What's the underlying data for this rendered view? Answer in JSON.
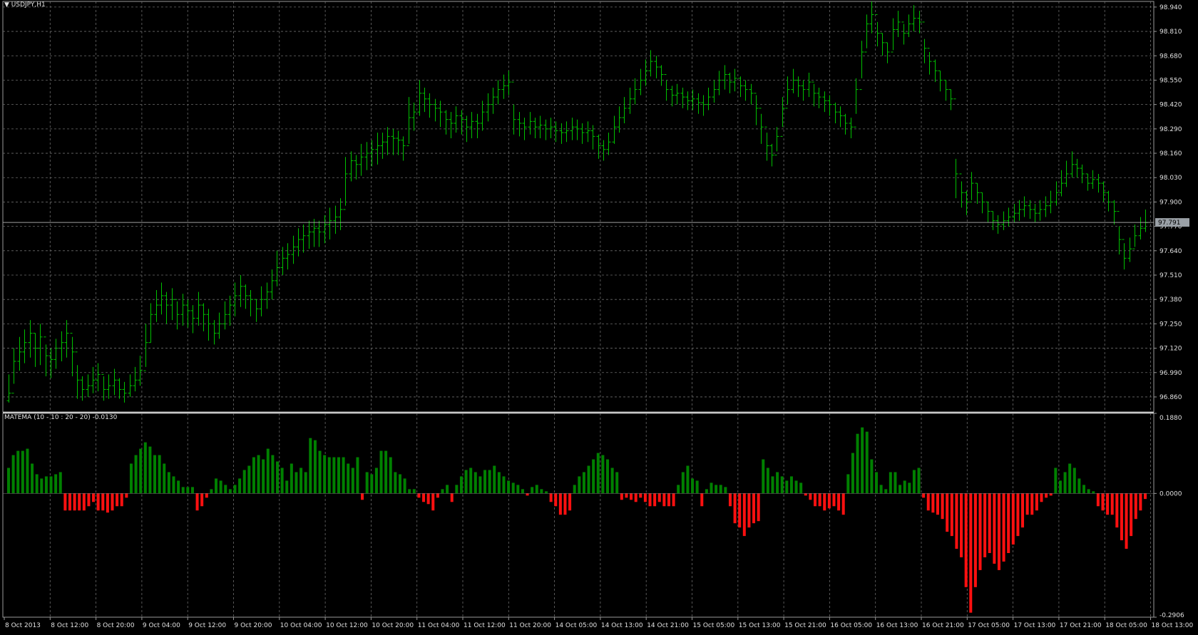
{
  "chart": {
    "symbol_label": "USDJPY,H1",
    "current_price_label": "97.791",
    "colors": {
      "background": "#000000",
      "grid": "#6b6b6b",
      "frame": "#9a9a9a",
      "bar": "#00c000",
      "hist_up": "#008000",
      "hist_down": "#ff1010",
      "price_tag_bg": "#9aa0a6",
      "axis_text": "#e0e0e0"
    }
  },
  "indicator": {
    "title": "MATEMA (10 - 10 : 20 - 20) -0.0130",
    "axis_labels": [
      "0.1880",
      "0.0000",
      "-0.2906"
    ]
  },
  "chart_data": [
    {
      "type": "ohlc",
      "title": "USDJPY,H1",
      "ylim": [
        96.78,
        98.97
      ],
      "y_ticks": [
        "98.940",
        "98.810",
        "98.680",
        "98.550",
        "98.420",
        "98.290",
        "98.160",
        "98.030",
        "97.900",
        "97.770",
        "97.640",
        "97.510",
        "97.380",
        "97.250",
        "97.120",
        "96.990",
        "96.860"
      ],
      "x_ticks": [
        "8 Oct 2013",
        "8 Oct 12:00",
        "8 Oct 20:00",
        "9 Oct 04:00",
        "9 Oct 12:00",
        "9 Oct 20:00",
        "10 Oct 04:00",
        "10 Oct 12:00",
        "10 Oct 20:00",
        "11 Oct 04:00",
        "11 Oct 12:00",
        "11 Oct 20:00",
        "14 Oct 05:00",
        "14 Oct 13:00",
        "14 Oct 21:00",
        "15 Oct 05:00",
        "15 Oct 13:00",
        "15 Oct 21:00",
        "16 Oct 05:00",
        "16 Oct 13:00",
        "16 Oct 21:00",
        "17 Oct 05:00",
        "17 Oct 13:00",
        "17 Oct 21:00",
        "18 Oct 05:00",
        "18 Oct 13:00"
      ],
      "closes": [
        96.88,
        97.05,
        97.1,
        97.15,
        97.2,
        97.12,
        97.18,
        97.08,
        97.06,
        97.12,
        97.15,
        97.2,
        97.1,
        96.95,
        96.9,
        96.92,
        96.95,
        96.98,
        96.9,
        96.92,
        96.95,
        96.9,
        96.88,
        96.92,
        96.95,
        97.0,
        97.15,
        97.3,
        97.35,
        97.4,
        97.35,
        97.38,
        97.3,
        97.35,
        97.32,
        97.28,
        97.35,
        97.3,
        97.25,
        97.2,
        97.25,
        97.3,
        97.35,
        97.4,
        97.45,
        97.4,
        97.38,
        97.33,
        97.38,
        97.42,
        97.48,
        97.55,
        97.6,
        97.62,
        97.66,
        97.7,
        97.72,
        97.74,
        97.76,
        97.74,
        97.78,
        97.8,
        97.82,
        97.86,
        98.05,
        98.12,
        98.1,
        98.14,
        98.16,
        98.18,
        98.2,
        98.22,
        98.25,
        98.24,
        98.23,
        98.2,
        98.35,
        98.38,
        98.48,
        98.45,
        98.42,
        98.4,
        98.38,
        98.34,
        98.32,
        98.36,
        98.34,
        98.3,
        98.33,
        98.32,
        98.38,
        98.42,
        98.46,
        98.5,
        98.52,
        98.54,
        98.34,
        98.32,
        98.3,
        98.33,
        98.3,
        98.31,
        98.29,
        98.3,
        98.28,
        98.27,
        98.28,
        98.3,
        98.29,
        98.27,
        98.28,
        98.25,
        98.2,
        98.18,
        98.22,
        98.3,
        98.35,
        98.4,
        98.45,
        98.5,
        98.55,
        98.6,
        98.65,
        98.62,
        98.58,
        98.5,
        98.47,
        98.48,
        98.46,
        98.44,
        98.45,
        98.43,
        98.42,
        98.46,
        98.5,
        98.55,
        98.58,
        98.54,
        98.56,
        98.52,
        98.5,
        98.48,
        98.4,
        98.3,
        98.2,
        98.15,
        98.25,
        98.4,
        98.5,
        98.55,
        98.52,
        98.5,
        98.54,
        98.48,
        98.46,
        98.44,
        98.42,
        98.38,
        98.36,
        98.32,
        98.3,
        98.5,
        98.7,
        98.85,
        98.9,
        98.8,
        98.75,
        98.7,
        98.82,
        98.86,
        98.8,
        98.85,
        98.88,
        98.86,
        98.72,
        98.65,
        98.6,
        98.55,
        98.5,
        98.45,
        98.05,
        97.95,
        97.9,
        98.0,
        97.95,
        97.9,
        97.85,
        97.8,
        97.78,
        97.8,
        97.82,
        97.84,
        97.86,
        97.88,
        97.86,
        97.84,
        97.86,
        97.88,
        97.9,
        97.95,
        98.0,
        98.05,
        98.1,
        98.08,
        98.05,
        98.0,
        98.02,
        98.0,
        97.95,
        97.9,
        97.85,
        97.7,
        97.6,
        97.65,
        97.72,
        97.76,
        97.79
      ],
      "lows": [
        96.83,
        96.93,
        97.0,
        97.04,
        97.07,
        97.02,
        97.03,
        96.97,
        96.96,
        97.01,
        97.05,
        97.07,
        96.97,
        96.85,
        96.84,
        96.86,
        96.88,
        96.89,
        96.84,
        96.85,
        96.87,
        96.85,
        96.83,
        96.86,
        96.89,
        96.92,
        97.02,
        97.15,
        97.26,
        97.3,
        97.25,
        97.27,
        97.22,
        97.24,
        97.23,
        97.2,
        97.24,
        97.21,
        97.16,
        97.14,
        97.17,
        97.22,
        97.24,
        97.29,
        97.34,
        97.33,
        97.29,
        97.26,
        97.29,
        97.33,
        97.38,
        97.45,
        97.51,
        97.54,
        97.57,
        97.61,
        97.63,
        97.65,
        97.66,
        97.66,
        97.68,
        97.7,
        97.73,
        97.75,
        97.88,
        98.01,
        98.02,
        98.04,
        98.07,
        98.09,
        98.1,
        98.13,
        98.15,
        98.15,
        98.15,
        98.12,
        98.21,
        98.28,
        98.36,
        98.38,
        98.35,
        98.33,
        98.3,
        98.26,
        98.24,
        98.27,
        98.26,
        98.22,
        98.24,
        98.24,
        98.28,
        98.33,
        98.37,
        98.42,
        98.45,
        98.47,
        98.26,
        98.25,
        98.23,
        98.26,
        98.24,
        98.24,
        98.23,
        98.24,
        98.22,
        98.21,
        98.22,
        98.23,
        98.23,
        98.21,
        98.22,
        98.18,
        98.13,
        98.12,
        98.15,
        98.21,
        98.27,
        98.32,
        98.37,
        98.42,
        98.47,
        98.52,
        98.57,
        98.56,
        98.52,
        98.44,
        98.41,
        98.42,
        98.4,
        98.39,
        98.39,
        98.37,
        98.36,
        98.39,
        98.43,
        98.47,
        98.5,
        98.48,
        98.49,
        98.46,
        98.44,
        98.42,
        98.31,
        98.21,
        98.12,
        98.09,
        98.17,
        98.3,
        98.42,
        98.48,
        98.46,
        98.44,
        98.46,
        98.41,
        98.4,
        98.38,
        98.36,
        98.32,
        98.3,
        98.26,
        98.24,
        98.37,
        98.56,
        98.72,
        98.8,
        98.73,
        98.68,
        98.64,
        98.71,
        98.78,
        98.74,
        98.78,
        98.81,
        98.8,
        98.64,
        98.58,
        98.54,
        98.49,
        98.44,
        98.39,
        97.92,
        97.87,
        97.83,
        97.91,
        97.89,
        97.84,
        97.79,
        97.75,
        97.73,
        97.75,
        97.77,
        97.79,
        97.8,
        97.82,
        97.81,
        97.79,
        97.8,
        97.82,
        97.84,
        97.88,
        97.93,
        97.98,
        98.03,
        98.03,
        98.0,
        97.96,
        97.97,
        97.95,
        97.9,
        97.85,
        97.78,
        97.62,
        97.54,
        97.58,
        97.66,
        97.7,
        97.74
      ],
      "highs": [
        96.98,
        97.12,
        97.18,
        97.22,
        97.27,
        97.2,
        97.25,
        97.14,
        97.12,
        97.17,
        97.21,
        97.27,
        97.18,
        97.03,
        96.97,
        96.98,
        97.02,
        97.04,
        96.97,
        96.98,
        97.01,
        96.96,
        96.94,
        96.98,
        97.02,
        97.08,
        97.25,
        97.36,
        97.43,
        97.47,
        97.42,
        97.44,
        97.37,
        97.41,
        97.38,
        97.35,
        97.42,
        97.36,
        97.33,
        97.27,
        97.31,
        97.37,
        97.4,
        97.47,
        97.51,
        97.46,
        97.43,
        97.38,
        97.45,
        97.47,
        97.54,
        97.64,
        97.66,
        97.68,
        97.72,
        97.76,
        97.78,
        97.8,
        97.81,
        97.8,
        97.83,
        97.87,
        97.88,
        97.92,
        98.14,
        98.17,
        98.15,
        98.21,
        98.22,
        98.23,
        98.27,
        98.27,
        98.3,
        98.29,
        98.28,
        98.25,
        98.46,
        98.43,
        98.55,
        98.51,
        98.48,
        98.45,
        98.44,
        98.39,
        98.38,
        98.41,
        98.39,
        98.36,
        98.38,
        98.37,
        98.44,
        98.48,
        98.51,
        98.55,
        98.58,
        98.6,
        98.42,
        98.38,
        98.35,
        98.38,
        98.35,
        98.36,
        98.34,
        98.35,
        98.33,
        98.32,
        98.33,
        98.35,
        98.34,
        98.32,
        98.33,
        98.31,
        98.26,
        98.23,
        98.27,
        98.36,
        98.41,
        98.46,
        98.51,
        98.56,
        98.61,
        98.66,
        98.71,
        98.68,
        98.63,
        98.55,
        98.52,
        98.53,
        98.51,
        98.49,
        98.5,
        98.48,
        98.47,
        98.51,
        98.55,
        98.6,
        98.63,
        98.59,
        98.61,
        98.57,
        98.55,
        98.53,
        98.47,
        98.37,
        98.27,
        98.21,
        98.3,
        98.46,
        98.57,
        98.61,
        98.57,
        98.55,
        98.59,
        98.53,
        98.51,
        98.49,
        98.47,
        98.43,
        98.41,
        98.37,
        98.35,
        98.56,
        98.76,
        98.9,
        98.97,
        98.86,
        98.8,
        98.75,
        98.88,
        98.92,
        98.85,
        98.9,
        98.95,
        98.92,
        98.77,
        98.7,
        98.66,
        98.6,
        98.55,
        98.5,
        98.13,
        98.01,
        97.96,
        98.06,
        98.0,
        97.95,
        97.9,
        97.85,
        97.83,
        97.85,
        97.87,
        97.89,
        97.91,
        97.93,
        97.91,
        97.89,
        97.91,
        97.93,
        97.96,
        98.01,
        98.07,
        98.12,
        98.17,
        98.13,
        98.1,
        98.05,
        98.07,
        98.05,
        98.01,
        97.96,
        97.91,
        97.77,
        97.68,
        97.71,
        97.78,
        97.82,
        97.86
      ]
    },
    {
      "type": "bar",
      "title": "MATEMA (10 - 10 : 20 - 20) -0.0130",
      "ylim": [
        -0.2906,
        0.188
      ],
      "values": [
        0.06,
        0.09,
        0.1,
        0.1,
        0.105,
        0.07,
        0.045,
        0.035,
        0.04,
        0.04,
        0.045,
        0.05,
        -0.04,
        -0.04,
        -0.04,
        -0.04,
        -0.04,
        -0.03,
        -0.02,
        -0.04,
        -0.04,
        -0.045,
        -0.04,
        -0.03,
        -0.03,
        -0.01,
        0.07,
        0.09,
        0.105,
        0.12,
        0.11,
        0.09,
        0.09,
        0.07,
        0.05,
        0.04,
        0.03,
        0.015,
        0.015,
        0.015,
        -0.04,
        -0.03,
        -0.01,
        0.01,
        0.035,
        0.03,
        0.02,
        0.01,
        0.02,
        0.035,
        0.055,
        0.065,
        0.085,
        0.09,
        0.08,
        0.105,
        0.09,
        0.075,
        0.06,
        0.03,
        0.07,
        0.05,
        0.06,
        0.05,
        0.13,
        0.125,
        0.1,
        0.09,
        0.085,
        0.085,
        0.085,
        0.085,
        0.07,
        0.06,
        0.085,
        -0.015,
        0.05,
        0.045,
        0.06,
        0.1,
        0.1,
        0.085,
        0.05,
        0.045,
        0.035,
        0.01,
        0.01,
        -0.01,
        -0.02,
        -0.025,
        -0.04,
        -0.01,
        0.01,
        0.02,
        -0.02,
        0.02,
        0.04,
        0.055,
        0.06,
        0.05,
        0.04,
        0.055,
        0.055,
        0.065,
        0.05,
        0.04,
        0.03,
        0.025,
        0.02,
        0.01,
        -0.005,
        0.015,
        0.02,
        0.01,
        0.005,
        -0.02,
        -0.03,
        -0.05,
        -0.05,
        -0.04,
        0.02,
        0.04,
        0.05,
        0.065,
        0.08,
        0.095,
        0.09,
        0.08,
        0.06,
        0.05,
        -0.015,
        -0.01,
        -0.015,
        -0.02,
        -0.01,
        -0.02,
        -0.03,
        -0.03,
        -0.02,
        -0.03,
        -0.03,
        -0.03,
        0.02,
        0.05,
        0.065,
        0.035,
        0.03,
        -0.03,
        0.01,
        0.025,
        0.02,
        0.02,
        0.015,
        -0.03,
        -0.07,
        -0.08,
        -0.1,
        -0.08,
        -0.07,
        -0.065,
        0.08,
        0.06,
        0.04,
        0.05,
        0.04,
        0.03,
        0.04,
        0.03,
        0.025,
        -0.005,
        -0.015,
        -0.03,
        -0.03,
        -0.04,
        -0.035,
        -0.03,
        -0.04,
        -0.05,
        0.045,
        0.095,
        0.14,
        0.155,
        0.145,
        0.08,
        0.05,
        0.02,
        0.01,
        0.05,
        0.05,
        0.02,
        0.03,
        0.025,
        0.055,
        0.06,
        -0.01,
        -0.04,
        -0.045,
        -0.05,
        -0.06,
        -0.09,
        -0.1,
        -0.13,
        -0.15,
        -0.22,
        -0.28,
        -0.22,
        -0.18,
        -0.15,
        -0.14,
        -0.165,
        -0.18,
        -0.16,
        -0.14,
        -0.12,
        -0.1,
        -0.08,
        -0.05,
        -0.05,
        -0.04,
        -0.02,
        -0.01,
        -0.005,
        0.06,
        0.03,
        0.05,
        0.07,
        0.06,
        0.035,
        0.02,
        0.01,
        0.005,
        -0.03,
        -0.04,
        -0.05,
        -0.05,
        -0.08,
        -0.11,
        -0.13,
        -0.1,
        -0.06,
        -0.04,
        -0.013
      ]
    }
  ]
}
